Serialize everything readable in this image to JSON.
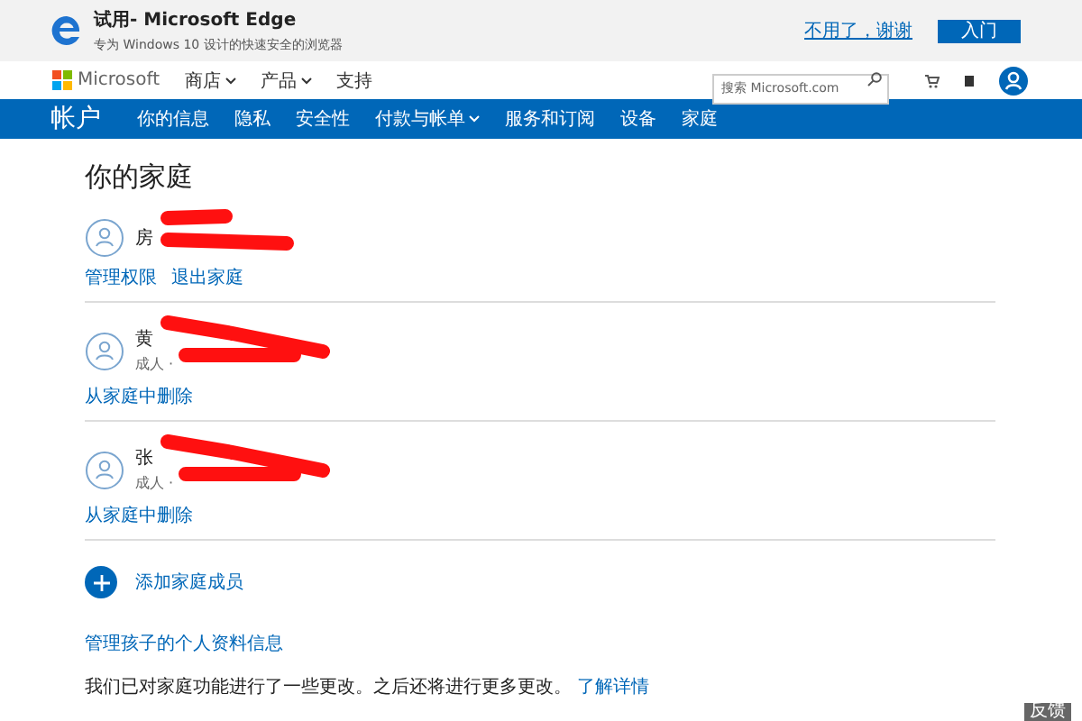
{
  "promo_banner": {
    "title": "试用- Microsoft Edge",
    "subtitle": "专为 Windows 10 设计的快速安全的浏览器",
    "dismiss_link": "不用了，谢谢",
    "button": "入门"
  },
  "header": {
    "brand": "Microsoft",
    "nav": [
      {
        "label": "商店",
        "dropdown": true
      },
      {
        "label": "产品",
        "dropdown": true
      },
      {
        "label": "支持",
        "dropdown": false
      }
    ],
    "search": {
      "placeholder": "搜索 Microsoft.com"
    }
  },
  "account_nav": {
    "title": "帐户",
    "items": [
      {
        "label": "你的信息",
        "dropdown": false
      },
      {
        "label": "隐私",
        "dropdown": false
      },
      {
        "label": "安全性",
        "dropdown": false
      },
      {
        "label": "付款与帐单",
        "dropdown": true
      },
      {
        "label": "服务和订阅",
        "dropdown": false
      },
      {
        "label": "设备",
        "dropdown": false
      },
      {
        "label": "家庭",
        "dropdown": false
      }
    ]
  },
  "page_title": "你的家庭",
  "members": [
    {
      "name": "房",
      "redacted": true,
      "links": [
        "管理权限",
        "退出家庭"
      ]
    },
    {
      "name": "黄",
      "role": "成人 ·",
      "redacted": true,
      "links": [
        "从家庭中删除"
      ]
    },
    {
      "name": "张",
      "role": "成人 ·",
      "redacted": true,
      "links": [
        "从家庭中删除"
      ]
    }
  ],
  "add_member": "添加家庭成员",
  "manage_child_link": "管理孩子的个人资料信息",
  "notice": {
    "text": "我们已对家庭功能进行了一些更改。之后还将进行更多更改。",
    "link": "了解详情"
  },
  "feedback_button": "反馈"
}
